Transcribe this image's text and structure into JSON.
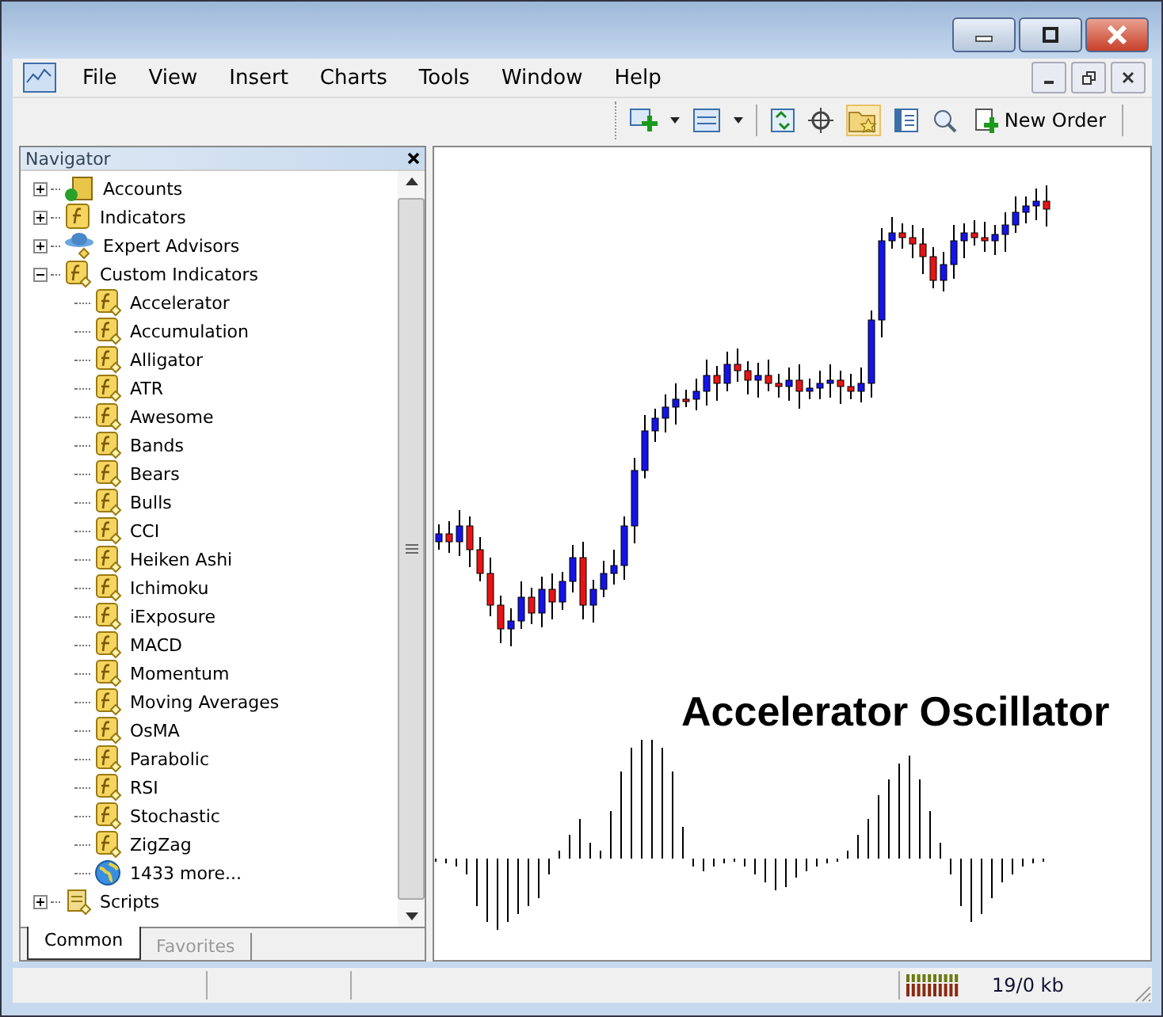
{
  "menu": [
    "File",
    "View",
    "Insert",
    "Charts",
    "Tools",
    "Window",
    "Help"
  ],
  "toolbar": {
    "new_order": "New Order"
  },
  "navigator": {
    "title": "Navigator",
    "tree": [
      {
        "label": "Accounts",
        "kind": "accounts",
        "expanded": false
      },
      {
        "label": "Indicators",
        "kind": "indicators",
        "expanded": false
      },
      {
        "label": "Expert Advisors",
        "kind": "experts",
        "expanded": false
      },
      {
        "label": "Custom Indicators",
        "kind": "custom",
        "expanded": true,
        "children": [
          {
            "label": "Accelerator",
            "kind": "indicator"
          },
          {
            "label": "Accumulation",
            "kind": "indicator"
          },
          {
            "label": "Alligator",
            "kind": "indicator"
          },
          {
            "label": "ATR",
            "kind": "indicator"
          },
          {
            "label": "Awesome",
            "kind": "indicator"
          },
          {
            "label": "Bands",
            "kind": "indicator"
          },
          {
            "label": "Bears",
            "kind": "indicator"
          },
          {
            "label": "Bulls",
            "kind": "indicator"
          },
          {
            "label": "CCI",
            "kind": "indicator"
          },
          {
            "label": "Heiken Ashi",
            "kind": "indicator"
          },
          {
            "label": "Ichimoku",
            "kind": "indicator"
          },
          {
            "label": "iExposure",
            "kind": "indicator"
          },
          {
            "label": "MACD",
            "kind": "indicator"
          },
          {
            "label": "Momentum",
            "kind": "indicator"
          },
          {
            "label": "Moving Averages",
            "kind": "indicator"
          },
          {
            "label": "OsMA",
            "kind": "indicator"
          },
          {
            "label": "Parabolic",
            "kind": "indicator"
          },
          {
            "label": "RSI",
            "kind": "indicator"
          },
          {
            "label": "Stochastic",
            "kind": "indicator"
          },
          {
            "label": "ZigZag",
            "kind": "indicator"
          },
          {
            "label": "1433 more...",
            "kind": "more"
          }
        ]
      },
      {
        "label": "Scripts",
        "kind": "scripts",
        "expanded": false
      }
    ],
    "tabs": [
      {
        "label": "Common",
        "selected": true
      },
      {
        "label": "Favorites",
        "selected": false
      }
    ]
  },
  "chart": {
    "caption": "Accelerator Oscillator"
  },
  "status_bar": {
    "traffic": "19/0 kb"
  }
}
